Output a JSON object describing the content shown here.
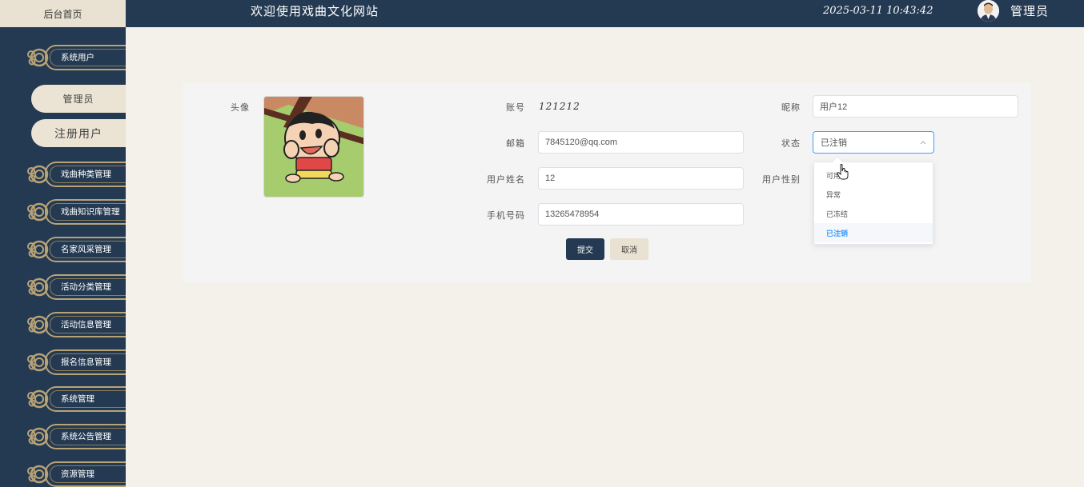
{
  "header": {
    "home_tab": "后台首页",
    "site_title": "欢迎使用戏曲文化网站",
    "datetime": "2025-03-11 10:43:42",
    "user_name": "管理员"
  },
  "sidebar": {
    "items": [
      {
        "label": "系统用户"
      },
      {
        "label": "管理员"
      },
      {
        "label": "注册用户"
      },
      {
        "label": "戏曲种类管理"
      },
      {
        "label": "戏曲知识库管理"
      },
      {
        "label": "名家风采管理"
      },
      {
        "label": "活动分类管理"
      },
      {
        "label": "活动信息管理"
      },
      {
        "label": "报名信息管理"
      },
      {
        "label": "系统管理"
      },
      {
        "label": "系统公告管理"
      },
      {
        "label": "资源管理"
      }
    ]
  },
  "form": {
    "avatar_label": "头像",
    "account_label": "账号",
    "account_value": "121212",
    "nickname_label": "昵称",
    "nickname_value": "用户12",
    "email_label": "邮箱",
    "email_value": "7845120@qq.com",
    "status_label": "状态",
    "status_value": "已注销",
    "realname_label": "用户姓名",
    "realname_value": "12",
    "gender_label": "用户性别",
    "phone_label": "手机号码",
    "phone_value": "13265478954",
    "submit_label": "提交",
    "cancel_label": "取消"
  },
  "status_dropdown": {
    "options": [
      "可用",
      "异常",
      "已冻结",
      "已注销"
    ],
    "selected": "已注销"
  },
  "colors": {
    "navy": "#243a52",
    "cream": "#e9e1d1",
    "gold": "#b8a377",
    "accent_blue": "#409eff"
  }
}
